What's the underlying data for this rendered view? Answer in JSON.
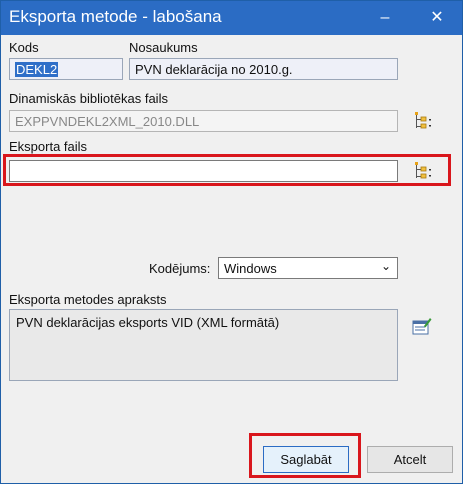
{
  "window": {
    "title": "Eksporta metode - labošana",
    "minimize": "–",
    "close": "✕"
  },
  "fields": {
    "kods_label": "Kods",
    "kods_value": "DEKL2",
    "nosaukums_label": "Nosaukums",
    "nosaukums_value": "PVN deklarācija no 2010.g.",
    "dll_label": "Dinamiskās bibliotēkas fails",
    "dll_value": "EXPPVNDEKL2XML_2010.DLL",
    "export_file_label": "Eksporta fails",
    "export_file_value": "",
    "encoding_label": "Kodējums:",
    "encoding_value": "Windows",
    "description_label": "Eksporta metodes apraksts",
    "description_value": "PVN deklarācijas eksports VID (XML formātā)"
  },
  "buttons": {
    "save": "Saglabāt",
    "cancel": "Atcelt"
  }
}
